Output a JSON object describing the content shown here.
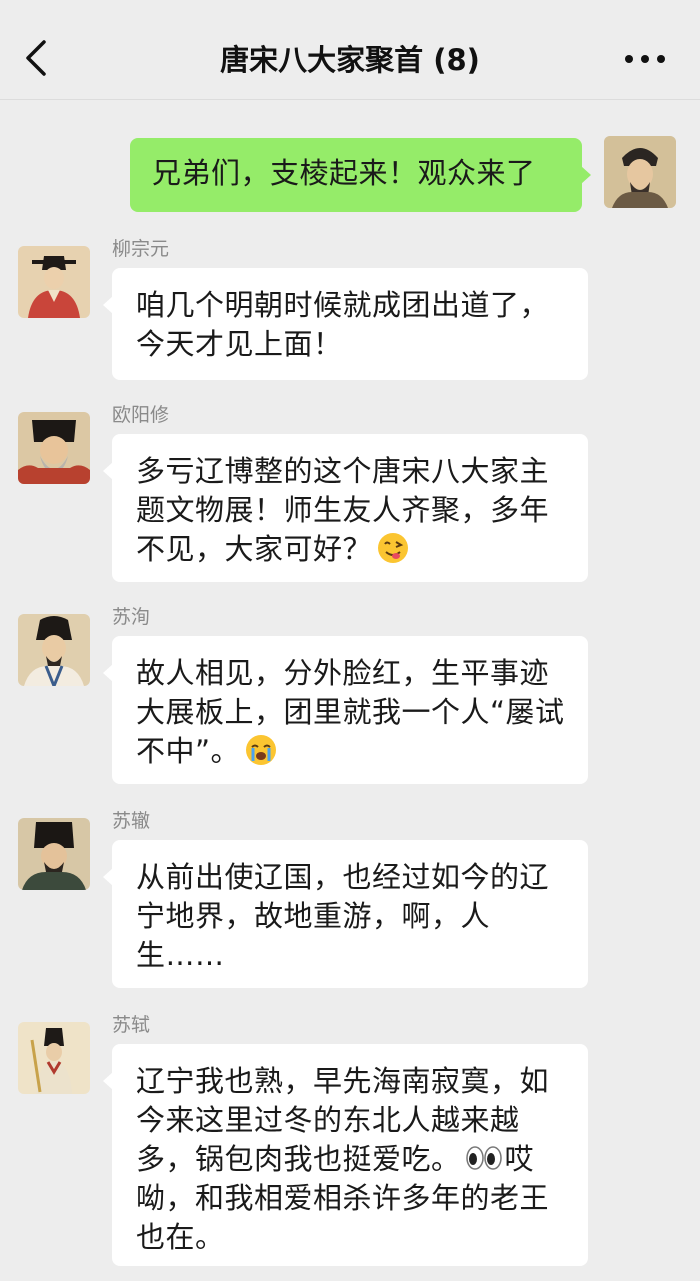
{
  "header": {
    "title": "唐宋八大家聚首 (8)",
    "back_icon": "chevron-left-icon",
    "more_icon": "more-horizontal-icon"
  },
  "colors": {
    "background": "#ededed",
    "own_bubble": "#95ec69",
    "other_bubble": "#ffffff",
    "sender_name": "#8a8a8a"
  },
  "messages": [
    {
      "sender": "",
      "own": true,
      "text": "兄弟们，支棱起来！观众来了"
    },
    {
      "sender": "柳宗元",
      "own": false,
      "text": "咱几个明朝时候就成团出道了，今天才见上面！"
    },
    {
      "sender": "欧阳修",
      "own": false,
      "text": "多亏辽博整的这个唐宋八大家主题文物展！师生友人齐聚，多年不见，大家可好？",
      "emoji": "wink-tongue-emoji"
    },
    {
      "sender": "苏洵",
      "own": false,
      "text": "故人相见，分外脸红，生平事迹大展板上，团里就我一个人“屡试不中”。",
      "emoji": "crying-emoji"
    },
    {
      "sender": "苏辙",
      "own": false,
      "text": "从前出使辽国，也经过如今的辽宁地界，故地重游，啊，人生……"
    },
    {
      "sender": "苏轼",
      "own": false,
      "text_before": "辽宁我也熟，早先海南寂寞，如今来这里过冬的东北人越来越多，锅包肉我也挺爱吃。",
      "emoji": "eyes-emoji",
      "text_after": "哎呦，和我相爱相杀许多年的老王也在。"
    }
  ]
}
